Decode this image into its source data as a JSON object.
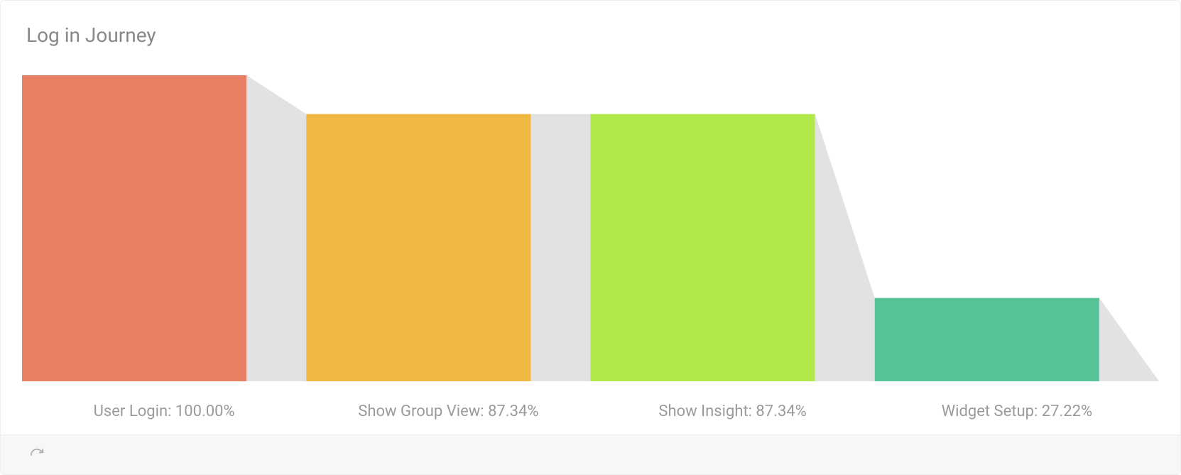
{
  "title": "Log in Journey",
  "footer": {
    "refresh_icon": "refresh"
  },
  "chart_data": {
    "type": "bar",
    "title": "Log in Journey",
    "categories": [
      "User Login",
      "Show Group View",
      "Show Insight",
      "Widget Setup"
    ],
    "values": [
      100.0,
      87.34,
      87.34,
      27.22
    ],
    "series": [
      {
        "name": "User Login",
        "value": 100.0,
        "color": "#e87e62"
      },
      {
        "name": "Show Group View",
        "value": 87.34,
        "color": "#f0b840"
      },
      {
        "name": "Show Insight",
        "value": 87.34,
        "color": "#b2e94a"
      },
      {
        "name": "Widget Setup",
        "value": 27.22,
        "color": "#57c397"
      }
    ],
    "connector_color": "#e2e2e2",
    "ylim": [
      0,
      100
    ],
    "labels": [
      "User Login: 100.00%",
      "Show Group View: 87.34%",
      "Show Insight: 87.34%",
      "Widget Setup: 27.22%"
    ]
  }
}
